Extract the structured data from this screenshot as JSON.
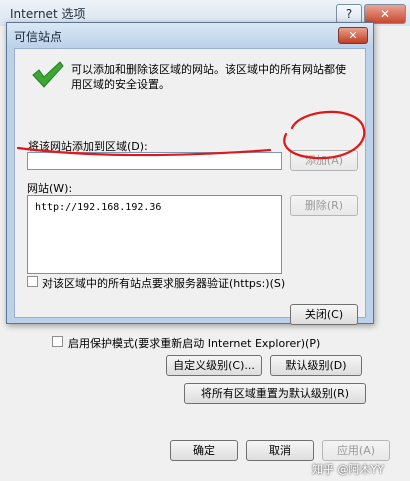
{
  "parent": {
    "title": "Internet 选项",
    "help_label": "?",
    "close_label": "✕",
    "protected_mode_label": "启用保护模式(要求重新启动 Internet Explorer)(P)",
    "custom_level_label": "自定义级别(C)...",
    "default_level_label": "默认级别(D)",
    "reset_all_label": "将所有区域重置为默认级别(R)",
    "ok_label": "确定",
    "cancel_label": "取消",
    "apply_label": "应用(A)"
  },
  "dialog": {
    "title": "可信站点",
    "close_label": "✕",
    "info_text_line1": "可以添加和删除该区域的网站。该区域中的所有网站都使",
    "info_text_line2": "用区域的安全设置。",
    "add_site_label": "将该网站添加到区域(D):",
    "url_input_value": "",
    "add_button_label": "添加(A)",
    "websites_label": "网站(W):",
    "sites": [
      "http://192.168.192.36"
    ],
    "remove_button_label": "删除(R)",
    "https_label": "对该区域中的所有站点要求服务器验证(https:)(S)",
    "close_button_label": "关闭(C)"
  },
  "watermark": "知乎 @阿木YY",
  "colors": {
    "annotation_red": "#e01818",
    "check_green": "#3aa832"
  }
}
